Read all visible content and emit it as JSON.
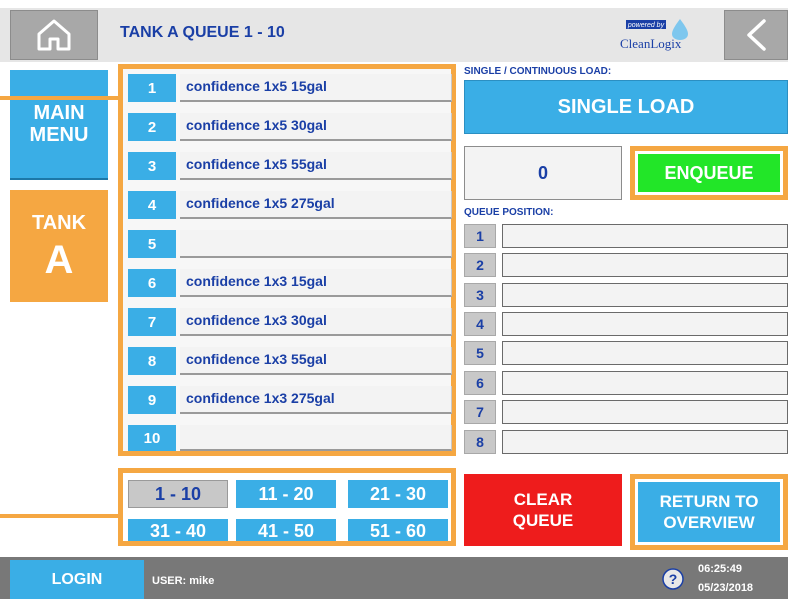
{
  "header": {
    "title": "TANK A QUEUE 1 - 10",
    "brand_top": "powered by",
    "brand_name": "CleanLogix"
  },
  "nav": {
    "main_menu_line1": "MAIN",
    "main_menu_line2": "MENU",
    "tank_label": "TANK",
    "tank_letter": "A"
  },
  "recipes": [
    {
      "num": "1",
      "name": "confidence 1x5 15gal"
    },
    {
      "num": "2",
      "name": "confidence 1x5 30gal"
    },
    {
      "num": "3",
      "name": "confidence 1x5 55gal"
    },
    {
      "num": "4",
      "name": "confidence 1x5 275gal"
    },
    {
      "num": "5",
      "name": ""
    },
    {
      "num": "6",
      "name": "confidence 1x3 15gal"
    },
    {
      "num": "7",
      "name": "confidence 1x3 30gal"
    },
    {
      "num": "8",
      "name": "confidence 1x3 55gal"
    },
    {
      "num": "9",
      "name": "confidence 1x3 275gal"
    },
    {
      "num": "10",
      "name": ""
    }
  ],
  "pages": [
    "1 - 10",
    "11 - 20",
    "21 - 30",
    "31 - 40",
    "41 - 50",
    "51 - 60"
  ],
  "load": {
    "label": "SINGLE / CONTINUOUS LOAD:",
    "mode": "SINGLE LOAD"
  },
  "count": "0",
  "enqueue_label": "ENQUEUE",
  "queue": {
    "label": "QUEUE POSITION:",
    "positions": [
      {
        "num": "1",
        "value": ""
      },
      {
        "num": "2",
        "value": ""
      },
      {
        "num": "3",
        "value": ""
      },
      {
        "num": "4",
        "value": ""
      },
      {
        "num": "5",
        "value": ""
      },
      {
        "num": "6",
        "value": ""
      },
      {
        "num": "7",
        "value": ""
      },
      {
        "num": "8",
        "value": ""
      }
    ]
  },
  "clear_line1": "CLEAR",
  "clear_line2": "QUEUE",
  "return_line1": "RETURN TO",
  "return_line2": "OVERVIEW",
  "footer": {
    "login": "LOGIN",
    "user": "USER: mike",
    "time": "06:25:49",
    "date": "05/23/2018"
  },
  "colors": {
    "accent_blue": "#3aaee6",
    "highlight_orange": "#f5a742",
    "enqueue_green": "#22e628",
    "clear_red": "#ee1c1c",
    "title_blue": "#1a3fa6"
  }
}
